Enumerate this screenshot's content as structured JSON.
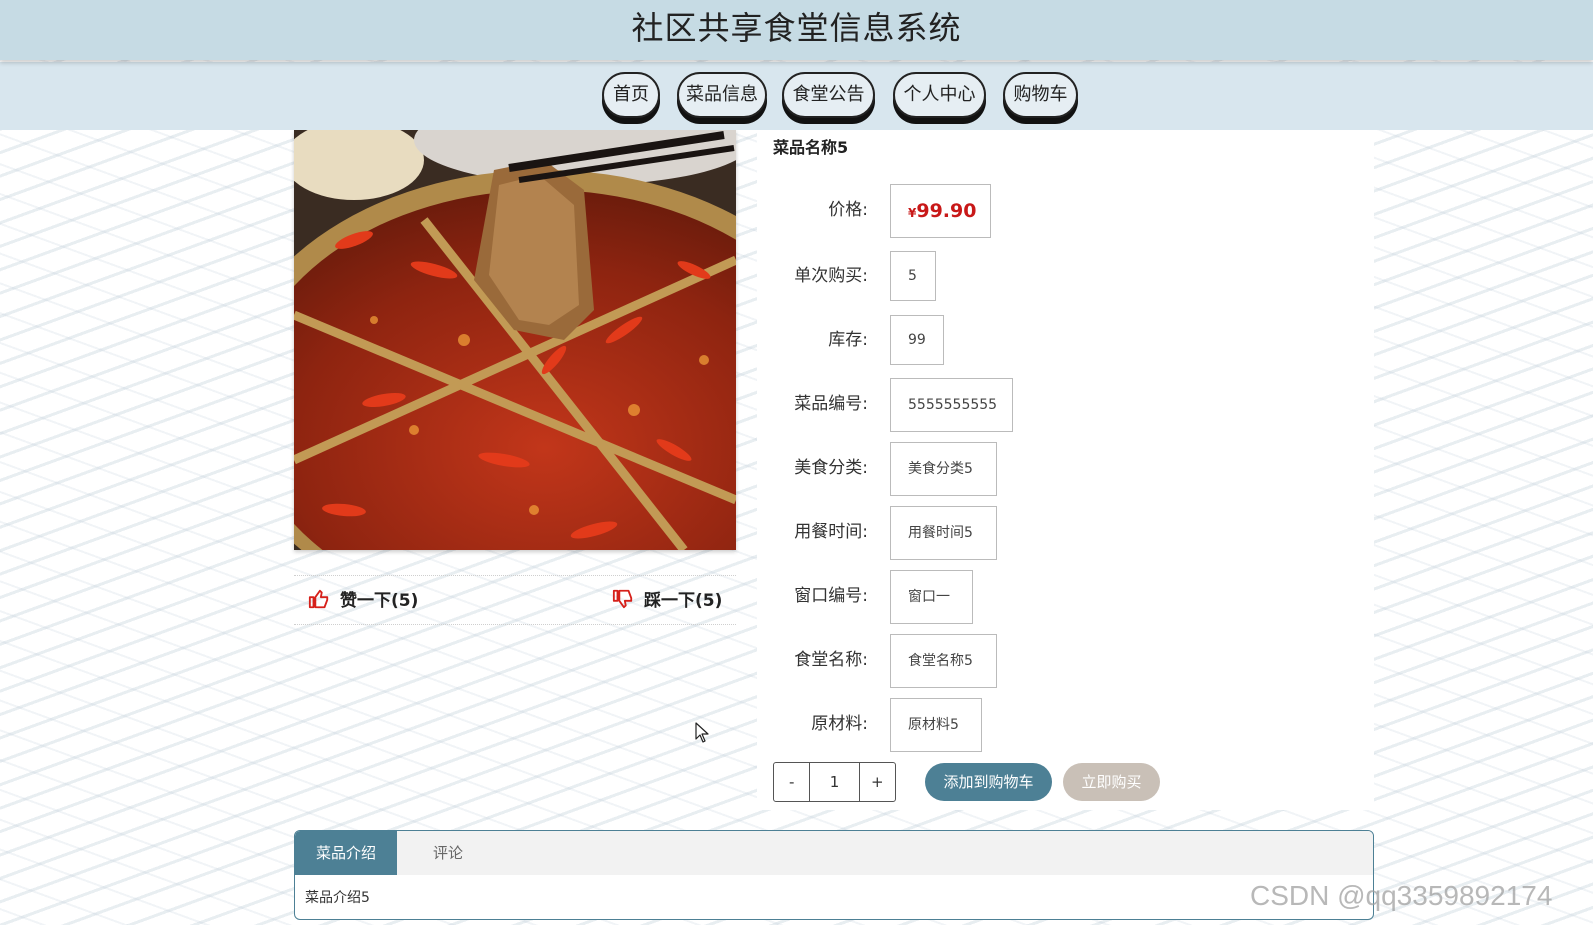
{
  "header": {
    "title": "社区共享食堂信息系统"
  },
  "nav": {
    "items": [
      {
        "label": "首页"
      },
      {
        "label": "菜品信息"
      },
      {
        "label": "食堂公告"
      },
      {
        "label": "个人中心"
      },
      {
        "label": "购物车"
      }
    ]
  },
  "dish": {
    "name": "菜品名称5",
    "price_currency": "¥",
    "price_value": "99.90",
    "fields": [
      {
        "label": "价格:"
      },
      {
        "label": "单次购买:",
        "value": "5"
      },
      {
        "label": "库存:",
        "value": "99"
      },
      {
        "label": "菜品编号:",
        "value": "5555555555"
      },
      {
        "label": "美食分类:",
        "value": "美食分类5"
      },
      {
        "label": "用餐时间:",
        "value": "用餐时间5"
      },
      {
        "label": "窗口编号:",
        "value": "窗口一"
      },
      {
        "label": "食堂名称:",
        "value": "食堂名称5"
      },
      {
        "label": "原材料:",
        "value": "原材料5"
      }
    ]
  },
  "votes": {
    "like_label": "赞一下(5)",
    "dislike_label": "踩一下(5)"
  },
  "quantity": {
    "minus": "-",
    "value": "1",
    "plus": "+"
  },
  "actions": {
    "add_to_cart": "添加到购物车",
    "buy_now": "立即购买"
  },
  "tabs": {
    "items": [
      {
        "label": "菜品介绍"
      },
      {
        "label": "评论"
      }
    ],
    "content": "菜品介绍5"
  },
  "watermark": "CSDN @qq3359892174",
  "colors": {
    "accent": "#4d8095",
    "price": "#c81818",
    "header_bg": "#c6dbe4",
    "nav_bg": "#d8e6ee"
  }
}
